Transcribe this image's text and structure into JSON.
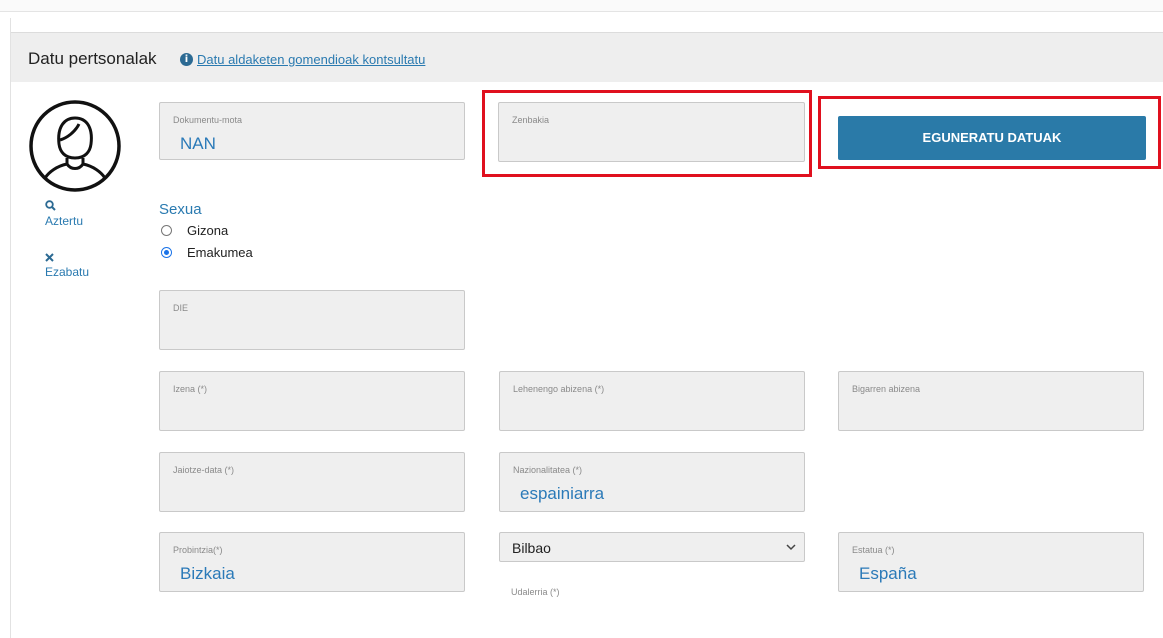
{
  "header": {
    "title": "Datu pertsonalak",
    "info_icon": "info-circle-icon",
    "link_text": "Datu aldaketen gomendioak kontsultatu"
  },
  "avatar": {
    "icon": "user-avatar-icon"
  },
  "side_actions": {
    "browse": {
      "icon": "search-icon",
      "label": "Aztertu"
    },
    "delete": {
      "icon": "close-icon",
      "label": "Ezabatu"
    }
  },
  "fields": {
    "document_type": {
      "label": "Dokumentu-mota",
      "value": "NAN"
    },
    "number": {
      "label": "Zenbakia",
      "value": ""
    },
    "die": {
      "label": "DIE",
      "value": ""
    },
    "first_name": {
      "label": "Izena (*)",
      "value": ""
    },
    "first_surname": {
      "label": "Lehenengo abizena (*)",
      "value": ""
    },
    "second_surname": {
      "label": "Bigarren abizena",
      "value": ""
    },
    "birth_date": {
      "label": "Jaiotze-data (*)",
      "value": ""
    },
    "nationality": {
      "label": "Nazionalitatea (*)",
      "value": "espainiarra"
    },
    "province": {
      "label": "Probintzia(*)",
      "value": "Bizkaia"
    },
    "municipality": {
      "label": "Udalerria (*)",
      "value": "Bilbao"
    },
    "state": {
      "label": "Estatua (*)",
      "value": "España"
    }
  },
  "update_button": {
    "label": "EGUNERATU DATUAK"
  },
  "gender": {
    "title": "Sexua",
    "options": [
      {
        "label": "Gizona",
        "selected": false
      },
      {
        "label": "Emakumea",
        "selected": true
      }
    ]
  },
  "colors": {
    "accent": "#2a7ab0",
    "button": "#2a7aa8",
    "highlight": "#e0101e",
    "field_bg": "#efefef"
  }
}
